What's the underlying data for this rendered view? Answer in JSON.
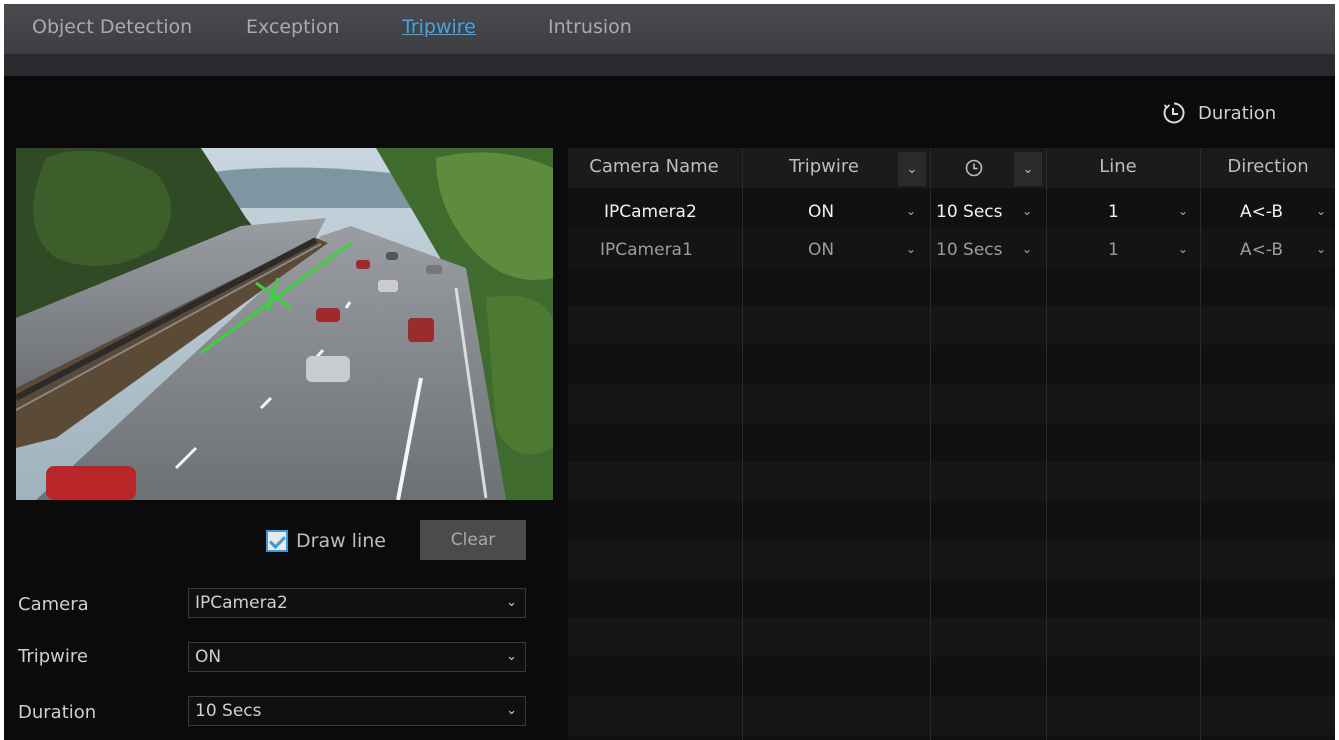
{
  "tabs": [
    {
      "label": "Object Detection"
    },
    {
      "label": "Exception"
    },
    {
      "label": "Tripwire",
      "active": true
    },
    {
      "label": "Intrusion"
    }
  ],
  "duration_button": {
    "label": "Duration",
    "icon": "clock-icon"
  },
  "preview": {
    "image": "highway-camera-view",
    "overlay": "green tripwire line"
  },
  "draw_line": {
    "label": "Draw line",
    "checked": true
  },
  "clear_button": {
    "label": "Clear"
  },
  "form": {
    "camera": {
      "label": "Camera",
      "value": "IPCamera2"
    },
    "tripwire": {
      "label": "Tripwire",
      "value": "ON"
    },
    "duration": {
      "label": "Duration",
      "value": "10 Secs"
    }
  },
  "table": {
    "columns": [
      "Camera Name",
      "Tripwire",
      "",
      "Line",
      "Direction"
    ],
    "header_icons": {
      "duration_column": "clock-icon"
    },
    "rows": [
      {
        "camera": "IPCamera2",
        "tripwire": "ON",
        "duration": "10 Secs",
        "line": "1",
        "direction": "A<-B"
      },
      {
        "camera": "IPCamera1",
        "tripwire": "ON",
        "duration": "10 Secs",
        "line": "1",
        "direction": "A<-B"
      }
    ]
  },
  "colors": {
    "accent": "#45a3e6",
    "tripwire_line": "#3bd23b"
  }
}
